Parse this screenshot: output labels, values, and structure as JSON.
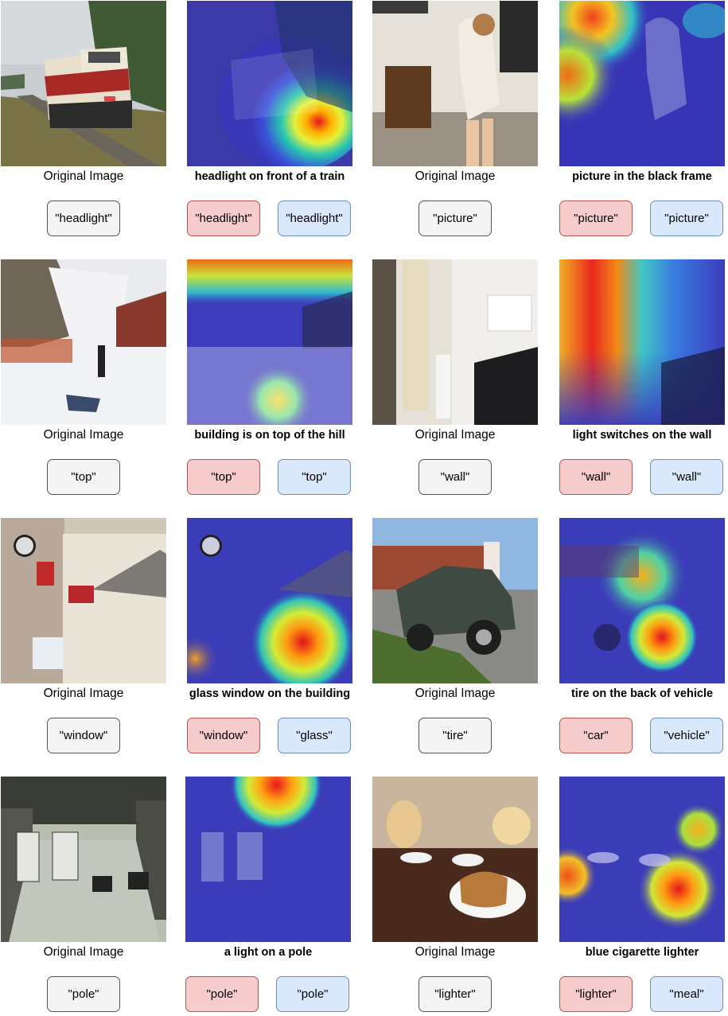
{
  "original_label": "Original Image",
  "rows": [
    {
      "left": {
        "caption": "headlight on front of a train",
        "query": "\"headlight\"",
        "pred_red": "\"headlight\"",
        "pred_blue": "\"headlight\""
      },
      "right": {
        "caption": "picture in the black frame",
        "query": "\"picture\"",
        "pred_red": "\"picture\"",
        "pred_blue": "\"picture\""
      }
    },
    {
      "left": {
        "caption": "building is on top of the hill",
        "query": "\"top\"",
        "pred_red": "\"top\"",
        "pred_blue": "\"top\""
      },
      "right": {
        "caption": "light switches on the wall",
        "query": "\"wall\"",
        "pred_red": "\"wall\"",
        "pred_blue": "\"wall\""
      }
    },
    {
      "left": {
        "caption": "glass window on the building",
        "query": "\"window\"",
        "pred_red": "\"window\"",
        "pred_blue": "\"glass\""
      },
      "right": {
        "caption": "tire on the back of vehicle",
        "query": "\"tire\"",
        "pred_red": "\"car\"",
        "pred_blue": "\"vehicle\""
      }
    },
    {
      "left": {
        "caption": "a light on a pole",
        "query": "\"pole\"",
        "pred_red": "\"pole\"",
        "pred_blue": "\"pole\""
      },
      "right": {
        "caption": "blue cigarette lighter",
        "query": "\"lighter\"",
        "pred_red": "\"lighter\"",
        "pred_blue": "\"meal\""
      }
    }
  ],
  "colors": {
    "query_fill": "#f4f4f4",
    "query_border": "#555555",
    "red_fill": "#f7cccc",
    "red_border": "#b85450",
    "blue_fill": "#dae8fc",
    "blue_border": "#6c8ebf"
  }
}
